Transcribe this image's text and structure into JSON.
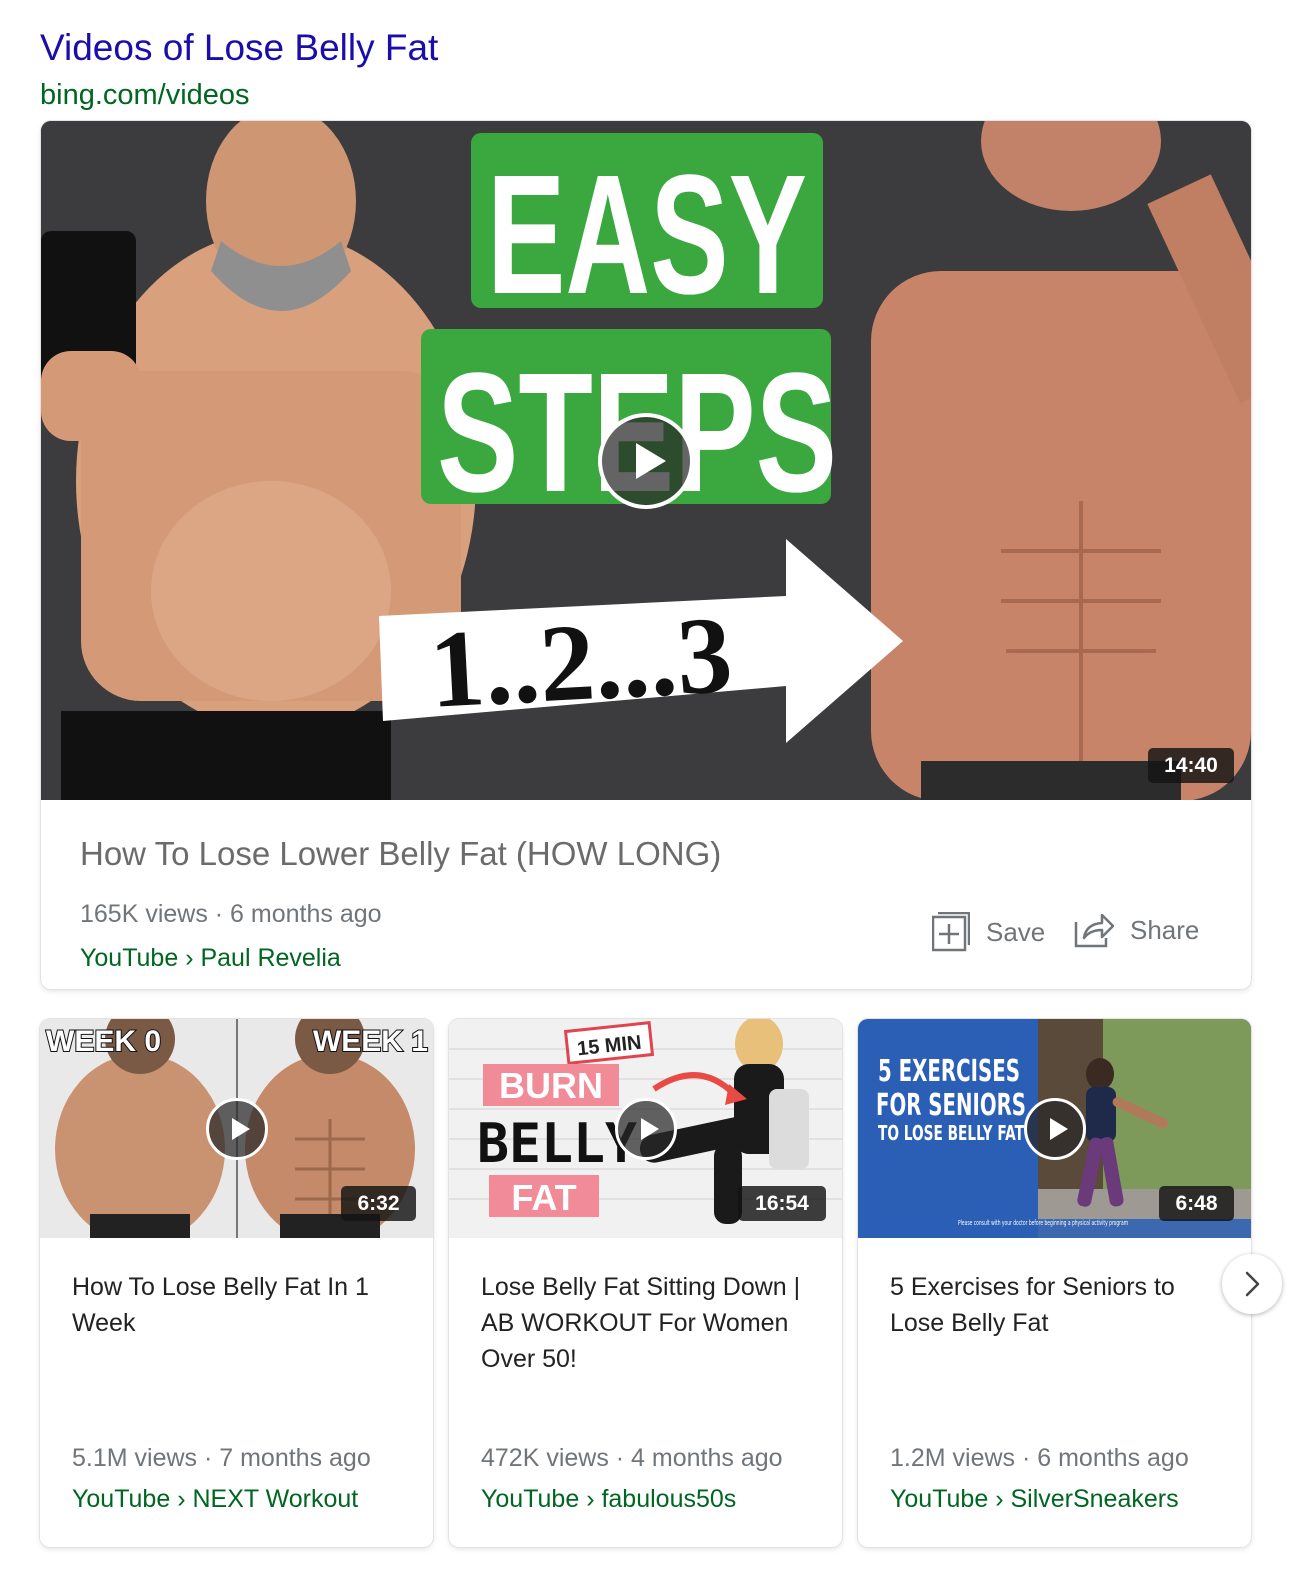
{
  "header": {
    "title": "Videos of Lose Belly Fat",
    "url": "bing.com/videos"
  },
  "featured": {
    "thumbnail_text": {
      "line1": "EASY",
      "line2": "STEPS",
      "arrow_text": "1..2...3"
    },
    "duration": "14:40",
    "title": "How To Lose Lower Belly Fat (HOW LONG)",
    "meta": "165K views · 6 months ago",
    "source": "YouTube › Paul Revelia",
    "save_label": "Save",
    "share_label": "Share"
  },
  "cards": [
    {
      "thumbnail_text": {
        "left": "WEEK 0",
        "right": "WEEK 1"
      },
      "duration": "6:32",
      "title": "How To Lose Belly Fat In 1 Week",
      "meta": "5.1M views · 7 months ago",
      "source": "YouTube › NEXT Workout"
    },
    {
      "thumbnail_text": {
        "tag": "15 MIN",
        "line1": "BURN",
        "line2": "BELLY",
        "line3": "FAT"
      },
      "duration": "16:54",
      "title": "Lose Belly Fat Sitting Down | AB WORKOUT For Women Over 50!",
      "meta": "472K views · 4 months ago",
      "source": "YouTube › fabulous50s"
    },
    {
      "thumbnail_text": {
        "line1": "5 EXERCISES",
        "line2": "FOR SENIORS",
        "line3": "TO LOSE BELLY FAT",
        "disclaimer": "Please consult with your doctor before beginning a physical activity program"
      },
      "duration": "6:48",
      "title": "5 Exercises for Seniors to Lose Belly Fat",
      "meta": "1.2M views · 6 months ago",
      "source": "YouTube › SilverSneakers"
    }
  ],
  "colors": {
    "title_link": "#1a0dab",
    "url_green": "#006621",
    "meta_gray": "#70757a",
    "thumb_green": "#3aa83f",
    "burn_pink": "#f28b98",
    "seniors_blue": "#2a5fb5"
  }
}
